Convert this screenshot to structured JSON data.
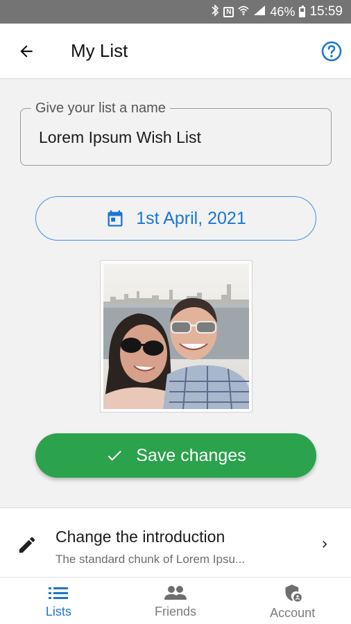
{
  "status_bar": {
    "battery": "46%",
    "time": "15:59",
    "icons": [
      "bluetooth-icon",
      "nfc-icon",
      "wifi-icon",
      "signal-icon",
      "battery-icon"
    ]
  },
  "app_bar": {
    "title": "My List",
    "back_icon": "arrow-back-icon",
    "help_icon": "help-circle-icon"
  },
  "form": {
    "name_label": "Give your list a name",
    "name_value": "Lorem Ipsum Wish List",
    "date_label": "1st April, 2021",
    "date_icon": "calendar-icon",
    "save_label": "Save changes",
    "save_icon": "check-icon"
  },
  "intro": {
    "title": "Change the introduction",
    "subtitle": "The standard chunk of Lorem Ipsu..."
  },
  "bottom_nav": {
    "items": [
      {
        "label": "Lists",
        "icon": "list-icon",
        "active": true
      },
      {
        "label": "Friends",
        "icon": "people-icon",
        "active": false
      },
      {
        "label": "Account",
        "icon": "account-shield-icon",
        "active": false
      }
    ]
  },
  "colors": {
    "accent": "#1976d2",
    "save": "#2ba24c",
    "status_bar": "#747474"
  }
}
